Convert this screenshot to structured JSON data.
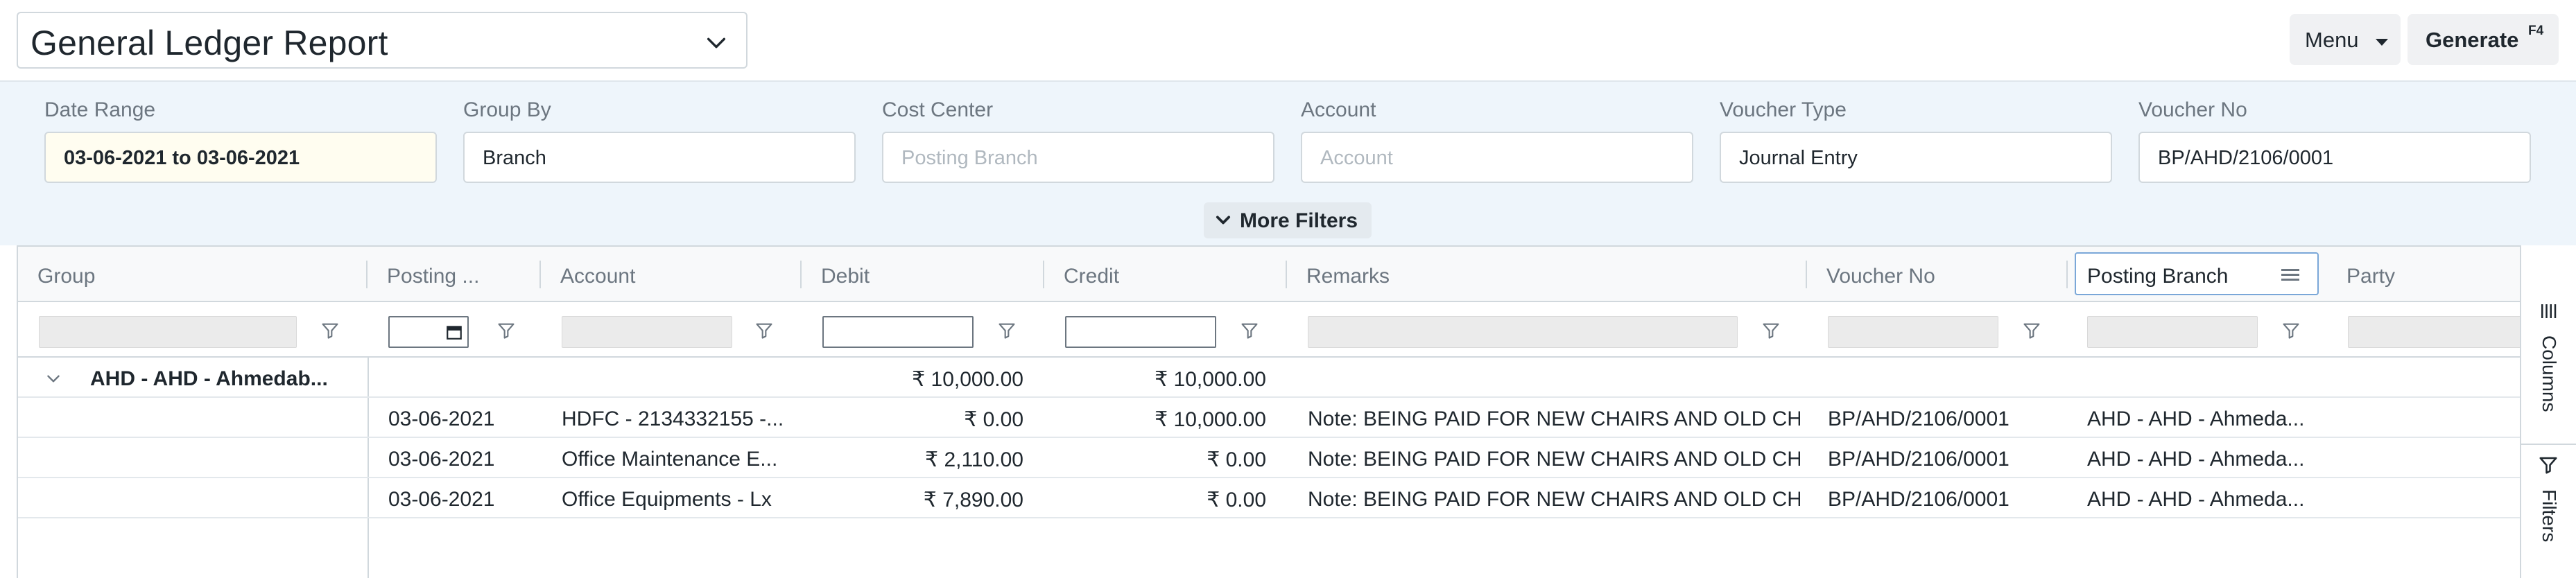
{
  "header": {
    "report_title": "General Ledger Report",
    "menu_label": "Menu",
    "generate_label": "Generate",
    "generate_shortcut": "F4"
  },
  "filters": {
    "date_range": {
      "label": "Date Range",
      "value": "03-06-2021 to 03-06-2021"
    },
    "group_by": {
      "label": "Group By",
      "value": "Branch"
    },
    "cost_center": {
      "label": "Cost Center",
      "placeholder": "Posting Branch"
    },
    "account": {
      "label": "Account",
      "placeholder": "Account"
    },
    "voucher_type": {
      "label": "Voucher Type",
      "value": "Journal Entry"
    },
    "voucher_no": {
      "label": "Voucher No",
      "value": "BP/AHD/2106/0001"
    },
    "more_filters_label": "More Filters"
  },
  "grid": {
    "columns": [
      "Group",
      "Posting ...",
      "Account",
      "Debit",
      "Credit",
      "Remarks",
      "Voucher No",
      "Posting Branch",
      "Party"
    ],
    "group_row": {
      "label": "AHD - AHD - Ahmedab...",
      "debit": "₹ 10,000.00",
      "credit": "₹ 10,000.00"
    },
    "rows": [
      {
        "posting": "03-06-2021",
        "account": "HDFC - 2134332155 -...",
        "debit": "₹ 0.00",
        "credit": "₹ 10,000.00",
        "remarks": "Note: BEING PAID FOR NEW CHAIRS AND OLD CH...",
        "voucher_no": "BP/AHD/2106/0001",
        "branch": "AHD - AHD - Ahmeda..."
      },
      {
        "posting": "03-06-2021",
        "account": "Office Maintenance E...",
        "debit": "₹ 2,110.00",
        "credit": "₹ 0.00",
        "remarks": "Note: BEING PAID FOR NEW CHAIRS AND OLD CH...",
        "voucher_no": "BP/AHD/2106/0001",
        "branch": "AHD - AHD - Ahmeda..."
      },
      {
        "posting": "03-06-2021",
        "account": "Office Equipments - Lx",
        "debit": "₹ 7,890.00",
        "credit": "₹ 0.00",
        "remarks": "Note: BEING PAID FOR NEW CHAIRS AND OLD CH...",
        "voucher_no": "BP/AHD/2106/0001",
        "branch": "AHD - AHD - Ahmeda..."
      }
    ]
  },
  "side_panel": {
    "columns_label": "Columns",
    "filters_label": "Filters"
  }
}
